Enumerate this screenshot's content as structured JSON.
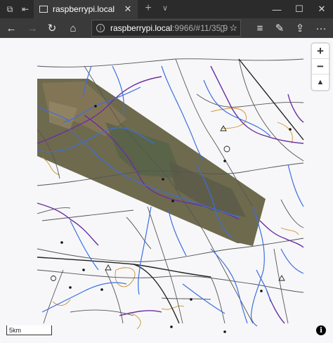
{
  "titlebar": {
    "tab_title": "raspberrypi.local",
    "new_tab_symbol": "+",
    "tab_list_symbol": "∨",
    "close_tab_symbol": "✕",
    "minimize_symbol": "—",
    "maximize_symbol": "☐",
    "close_symbol": "✕"
  },
  "navbar": {
    "back_symbol": "←",
    "forward_symbol": "→",
    "refresh_symbol": "↻",
    "home_symbol": "⌂",
    "url_host": "raspberrypi.local",
    "url_path": ":9966/#11/35.9",
    "favorites_symbol": "☆",
    "hub_symbol": "≡",
    "notes_symbol": "✎",
    "share_symbol": "⇪",
    "more_symbol": "···"
  },
  "map": {
    "zoom_in": "+",
    "zoom_out": "−",
    "reset_bearing": "▲",
    "scale_label": "5km",
    "attribution_symbol": "i",
    "colors": {
      "background": "#f7f7f9",
      "roads": "#555555",
      "rivers": "#3b6fe0",
      "boundaries": "#6b2fa0",
      "contours": "#c8922a"
    }
  }
}
